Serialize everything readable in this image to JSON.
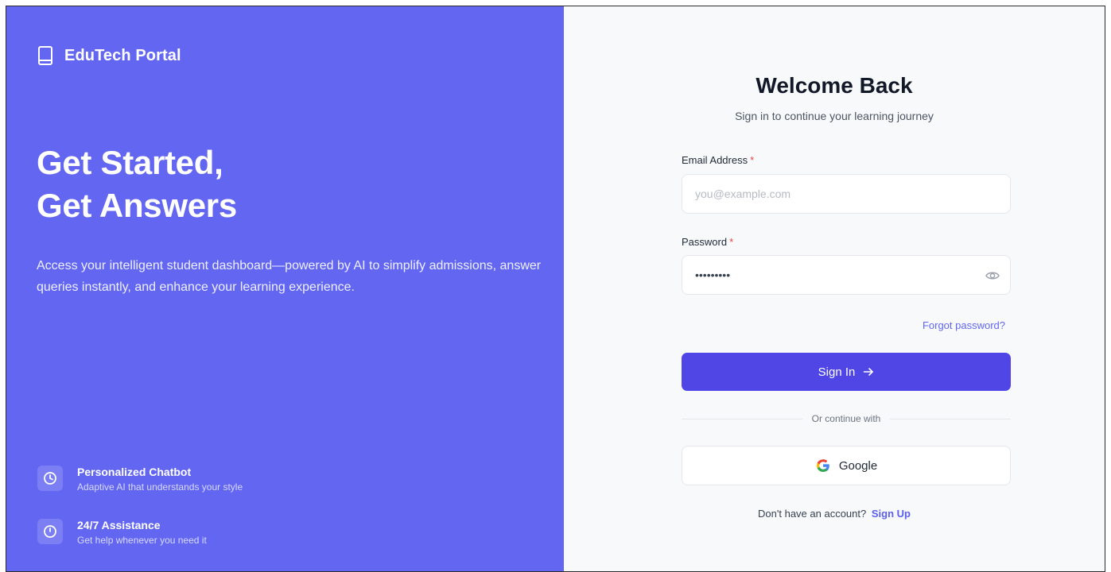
{
  "brand": {
    "name": "EduTech Portal",
    "icon": "book-icon"
  },
  "hero": {
    "line1": "Get Started,",
    "line2": "Get Answers"
  },
  "description": "Access your intelligent student dashboard—powered by AI to simplify admissions, answer queries instantly, and enhance your learning experience.",
  "features": [
    {
      "title": "Personalized Chatbot",
      "subtitle": "Adaptive AI that understands your style",
      "icon": "clock-icon"
    },
    {
      "title": "24/7 Assistance",
      "subtitle": "Get help whenever you need it",
      "icon": "power-icon"
    }
  ],
  "form": {
    "title": "Welcome Back",
    "subtitle": "Sign in to continue your learning journey",
    "email": {
      "label": "Email Address",
      "required_mark": "*",
      "placeholder": "you@example.com",
      "value": ""
    },
    "password": {
      "label": "Password",
      "required_mark": "*",
      "value": "passw0rd!"
    },
    "forgot": "Forgot password?",
    "signin": "Sign In",
    "divider": "Or continue with",
    "google": "Google",
    "signup_prompt": "Don't have an account?",
    "signup_link": "Sign Up"
  },
  "colors": {
    "left_bg": "#6366f1",
    "right_bg": "#f8f9fb",
    "primary_button": "#4f46e5",
    "link": "#6366f1",
    "required": "#ef4444"
  }
}
